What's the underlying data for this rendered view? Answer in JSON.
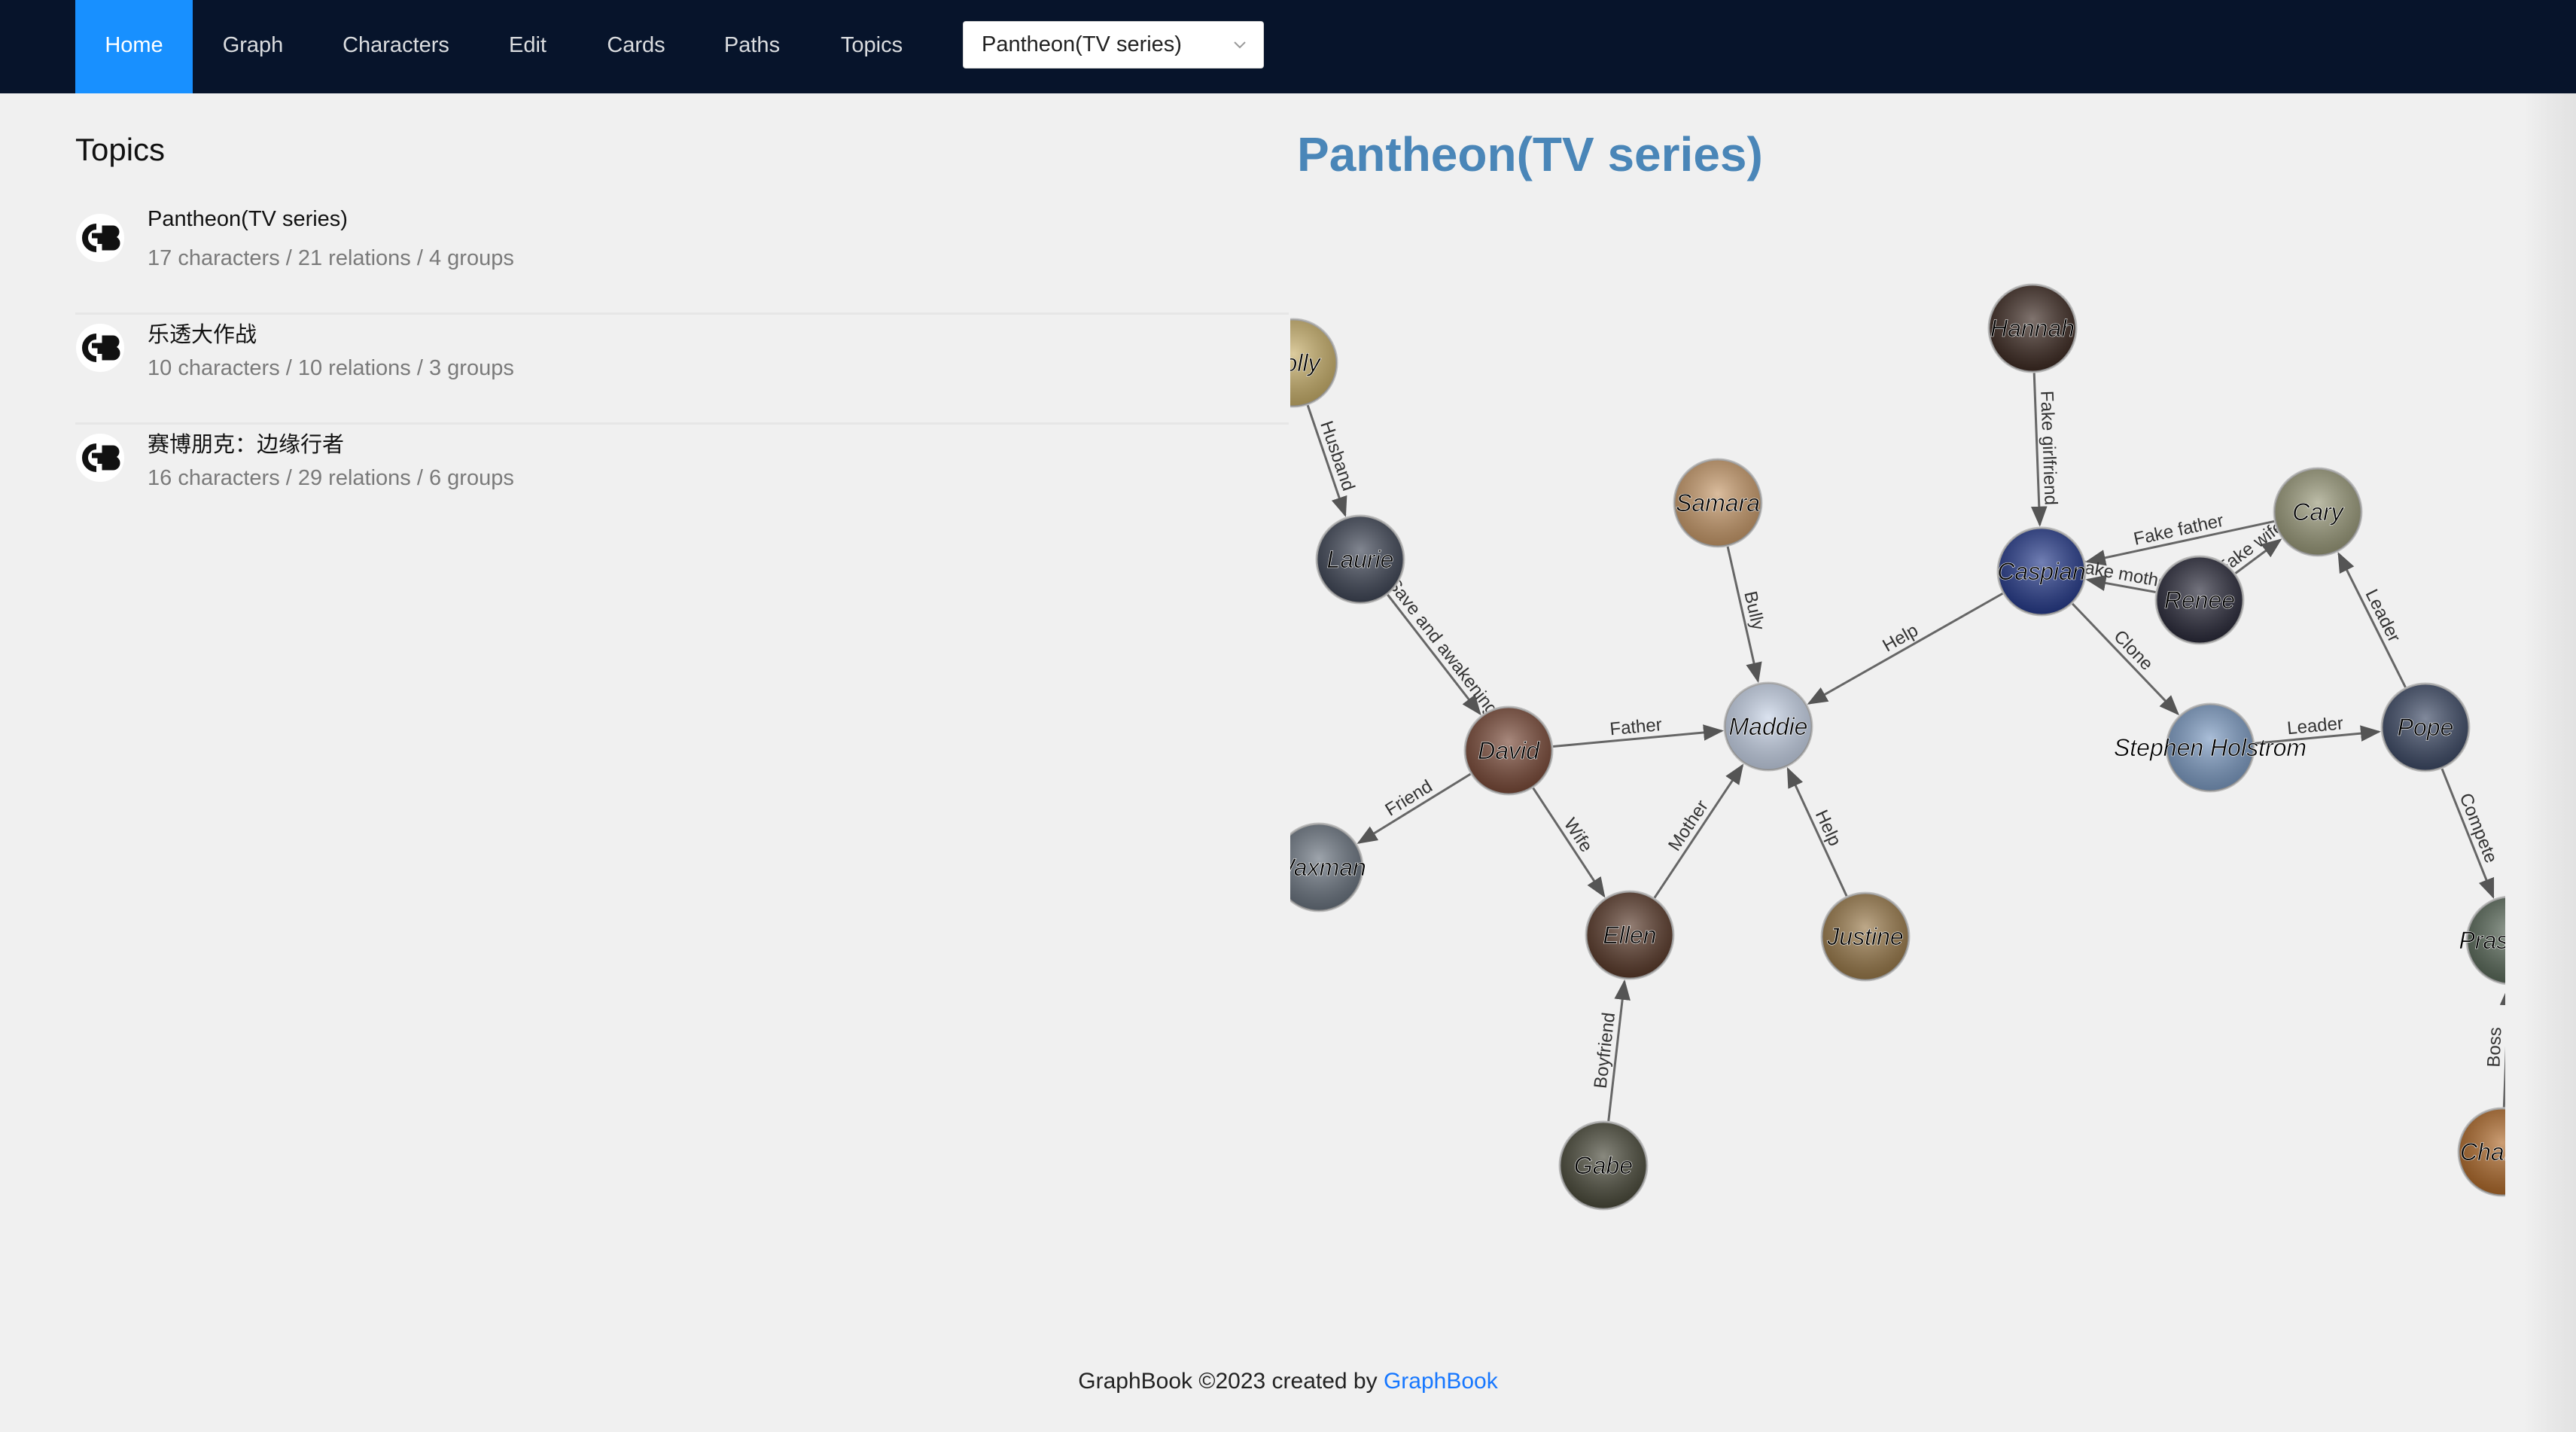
{
  "nav": {
    "items": [
      "Home",
      "Graph",
      "Characters",
      "Edit",
      "Cards",
      "Paths",
      "Topics"
    ],
    "active": "Home",
    "select_value": "Pantheon(TV series)"
  },
  "topics": {
    "heading": "Topics",
    "items": [
      {
        "name": "Pantheon(TV series)",
        "stats": "17 characters / 21 relations / 4 groups"
      },
      {
        "name": "乐透大作战",
        "stats": "10 characters / 10 relations / 3 groups"
      },
      {
        "name": "赛博朋克：边缘行者",
        "stats": "16 characters / 29 relations / 6 groups"
      }
    ]
  },
  "graph": {
    "title": "Pantheon(TV series)",
    "nodes": [
      {
        "id": "holly",
        "label": "Holly",
        "color": "#c9b06a"
      },
      {
        "id": "laurie",
        "label": "Laurie",
        "color": "#3f4656"
      },
      {
        "id": "samara",
        "label": "Samara",
        "color": "#c89a6a"
      },
      {
        "id": "hannah",
        "label": "Hannah",
        "color": "#3d2a22"
      },
      {
        "id": "caspian",
        "label": "Caspian",
        "color": "#263b8c"
      },
      {
        "id": "cary",
        "label": "Cary",
        "color": "#9a9a7a"
      },
      {
        "id": "renee",
        "label": "Renee",
        "color": "#2a2a3a"
      },
      {
        "id": "david",
        "label": "David",
        "color": "#7a4a38"
      },
      {
        "id": "maddie",
        "label": "Maddie",
        "color": "#c8d4e8"
      },
      {
        "id": "stephen",
        "label": "Stephen Holstrom",
        "color": "#7d9cc4"
      },
      {
        "id": "pope",
        "label": "Pope",
        "color": "#3d4a66"
      },
      {
        "id": "waxman",
        "label": "Waxman",
        "color": "#6a7480"
      },
      {
        "id": "ellen",
        "label": "Ellen",
        "color": "#5a3a2a"
      },
      {
        "id": "justine",
        "label": "Justine",
        "color": "#9a7a4a"
      },
      {
        "id": "gabe",
        "label": "Gabe",
        "color": "#4a4a3a"
      },
      {
        "id": "prasanna",
        "label": "Prasanna",
        "color": "#5a6a5a"
      },
      {
        "id": "chanda",
        "label": "Chanda",
        "color": "#b06a2a"
      }
    ],
    "edges": [
      {
        "from": "holly",
        "to": "laurie",
        "label": "Husband"
      },
      {
        "from": "laurie",
        "to": "david",
        "label": "Save and awakening"
      },
      {
        "from": "samara",
        "to": "maddie",
        "label": "Bully"
      },
      {
        "from": "hannah",
        "to": "caspian",
        "label": "Fake girlfriend"
      },
      {
        "from": "cary",
        "to": "caspian",
        "label": "Fake father"
      },
      {
        "from": "renee",
        "to": "caspian",
        "label": "Fake mother"
      },
      {
        "from": "renee",
        "to": "cary",
        "label": "Fake wife"
      },
      {
        "from": "caspian",
        "to": "maddie",
        "label": "Help"
      },
      {
        "from": "caspian",
        "to": "stephen",
        "label": "Clone"
      },
      {
        "from": "pope",
        "to": "cary",
        "label": "Leader"
      },
      {
        "from": "stephen",
        "to": "pope",
        "label": "Leader"
      },
      {
        "from": "david",
        "to": "maddie",
        "label": "Father"
      },
      {
        "from": "david",
        "to": "waxman",
        "label": "Friend"
      },
      {
        "from": "david",
        "to": "ellen",
        "label": "Wife"
      },
      {
        "from": "ellen",
        "to": "maddie",
        "label": "Mother"
      },
      {
        "from": "justine",
        "to": "maddie",
        "label": "Help"
      },
      {
        "from": "gabe",
        "to": "ellen",
        "label": "Boyfriend"
      },
      {
        "from": "pope",
        "to": "prasanna",
        "label": "Compete"
      },
      {
        "from": "chanda",
        "to": "prasanna",
        "label": "Boss"
      }
    ]
  },
  "footer": {
    "text": "GraphBook ©2023 created by",
    "link": "GraphBook"
  }
}
